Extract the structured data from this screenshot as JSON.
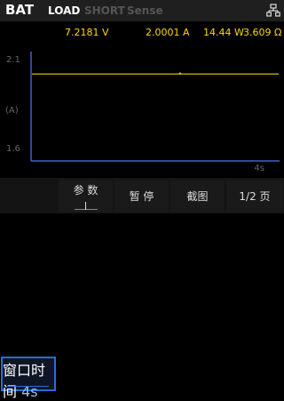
{
  "header": {
    "mode": "BAT",
    "tabs": [
      {
        "label": "LOAD",
        "active": true
      },
      {
        "label": "SHORT",
        "active": false
      },
      {
        "label": "Sense",
        "active": false
      }
    ],
    "network_icon": "network-icon"
  },
  "readings": {
    "voltage": "7.2181 V",
    "current": "2.0001 A",
    "power": "14.44 W",
    "resistance": "3.609 Ω"
  },
  "plot": {
    "y_top": "2.1",
    "y_unit": "(A)",
    "y_bottom": "1.6",
    "x_window": "4s",
    "trace_color": "#e6d200",
    "axis_color": "#3d63c9"
  },
  "softkeys": {
    "window": {
      "label": "窗口时间",
      "value": "4s"
    },
    "params": {
      "label": "参 数"
    },
    "pause": {
      "label": "暂 停"
    },
    "screenshot": {
      "label": "截图"
    },
    "page": {
      "label": "1/2 页"
    }
  },
  "chart_data": {
    "type": "line",
    "title": "",
    "xlabel": "",
    "ylabel": "(A)",
    "ylim": [
      1.6,
      2.1
    ],
    "x_window": "4s",
    "series": [
      {
        "values": [
          2.0001,
          2.0001,
          2.0001,
          2.0001,
          2.0001
        ]
      }
    ]
  }
}
